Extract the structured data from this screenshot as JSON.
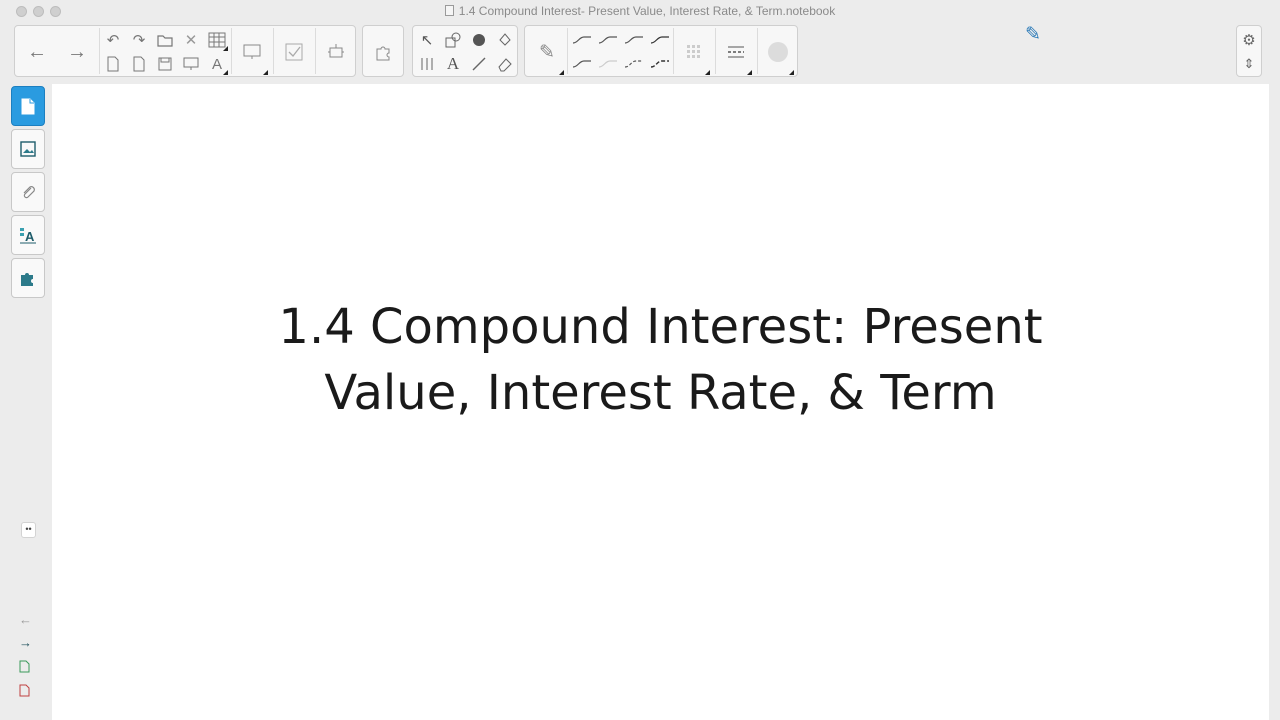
{
  "window": {
    "title": "1.4 Compound Interest- Present Value, Interest Rate, & Term.notebook"
  },
  "toolbar": {
    "icons": {
      "back": "←",
      "forward": "→",
      "undo": "↶",
      "redo": "↷",
      "delete": "✕",
      "text": "A",
      "pen": "✎",
      "select": "↖",
      "settings": "⚙",
      "collapse": "⇕"
    }
  },
  "sidebar": {
    "tabs": [
      "page-sorter",
      "gallery",
      "attachments",
      "properties",
      "add-ons"
    ],
    "expander": "••",
    "icons": {
      "page": "🗎",
      "gallery": "▣",
      "attach": "⌇",
      "props": "A",
      "addons": "✚",
      "prev": "←",
      "next": "→"
    }
  },
  "page": {
    "heading_line1": "1.4 Compound Interest: Present",
    "heading_line2": "Value, Interest Rate, & Term"
  },
  "colors": {
    "accent": "#2a9be0",
    "icon_teal": "#2c7a8a"
  }
}
